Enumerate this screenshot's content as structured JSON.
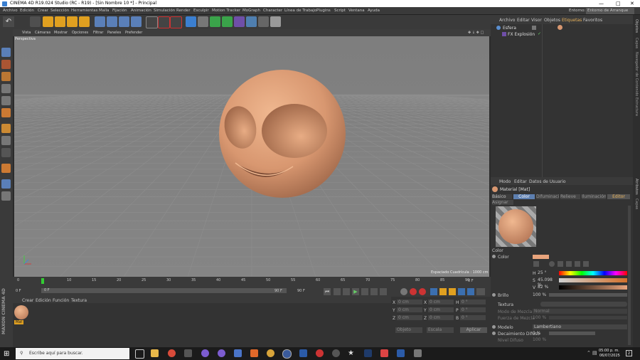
{
  "window": {
    "title": "CINEMA 4D R19.024 Studio (RC - R19) - [Sin Nombre 10 *] - Principal"
  },
  "menu": [
    "Archivo",
    "Edición",
    "Crear",
    "Selección",
    "Herramientas",
    "Malla",
    "Fijación",
    "Animación",
    "Simulación",
    "Render",
    "Esculpir",
    "Motion Tracker",
    "MoGraph",
    "Character",
    "Línea de Trabajo",
    "Plugins",
    "Script",
    "Ventana",
    "Ayuda"
  ],
  "layout_label": "Entorno:",
  "layout_value": "Entorno de Arranque",
  "viewport": {
    "menu": [
      "Vista",
      "Cámaras",
      "Mostrar",
      "Opciones",
      "Filtrar",
      "Paneles",
      "Prefender"
    ],
    "label": "Perspectiva",
    "grid_status": "Espaciado Cuadrícula : 1000 cm"
  },
  "timeline": {
    "ticks": [
      "0",
      "5",
      "10",
      "15",
      "20",
      "25",
      "30",
      "35",
      "40",
      "45",
      "50",
      "55",
      "60",
      "65",
      "70",
      "75",
      "80",
      "85",
      "90"
    ],
    "end_frame": "0 F",
    "current_frame": "0 F",
    "start_field": "0 F",
    "end_field": "90 F",
    "max_field": "90 F"
  },
  "material_manager": {
    "menu": [
      "Crear",
      "Edición",
      "Función",
      "Textura"
    ],
    "material_name": "Mat"
  },
  "coords": {
    "rows": [
      {
        "a": "X",
        "av": "0 cm",
        "b": "X",
        "bv": "0 cm",
        "c": "H",
        "cv": "0 °"
      },
      {
        "a": "Y",
        "av": "0 cm",
        "b": "Y",
        "bv": "0 cm",
        "c": "P",
        "cv": "0 °"
      },
      {
        "a": "Z",
        "av": "0 cm",
        "b": "Z",
        "bv": "0 cm",
        "c": "B",
        "cv": "0 °"
      }
    ],
    "mode": "Objeto",
    "size_mode": "Escala",
    "apply": "Aplicar"
  },
  "object_manager": {
    "menu": [
      "Archivo",
      "Editar",
      "Visor",
      "Objetos",
      "Etiquetas",
      "Favoritos"
    ],
    "items": [
      "Esfera",
      "FX Explosión"
    ]
  },
  "attributes": {
    "menu": [
      "Modo",
      "Editar",
      "Datos de Usuario"
    ],
    "title": "Material [Mat]",
    "tabs": [
      "Básico",
      "Color",
      "Difuminación",
      "Relieve",
      "Iluminación",
      "Editor",
      "Asignar"
    ],
    "section": "Color",
    "color_label": "Color",
    "h_label": "H",
    "h_value": "25 °",
    "s_label": "S",
    "s_value": "45.098 %",
    "v_label": "V",
    "v_value": "82 %",
    "brillo_label": "Brillo",
    "brillo_value": "100 %",
    "textura_label": "Textura",
    "mezcla_label": "Modo de Mezcla",
    "mezcla_value": "Normal",
    "fuerza_label": "Fuerza de Mezcla",
    "fuerza_value": "100 %",
    "modelo_label": "Modelo",
    "modelo_value": "Lambertiano",
    "decaimiento_label": "Decaimiento Difuso",
    "decaimiento_value": "0 %",
    "nivel_label": "Nivel Difuso",
    "nivel_value": "100 %",
    "swatch_color": "#e8a47c"
  },
  "side_tabs": [
    "Objetos",
    "Capas",
    "Navegador de Contenido",
    "Estructura"
  ],
  "side_tabs_lower": [
    "Atributos",
    "Capas"
  ],
  "taskbar": {
    "search_placeholder": "Escribe aquí para buscar.",
    "time": "05:00 p. m.",
    "date": "06/07/2025",
    "notifications": "2"
  },
  "colors": {
    "accent": "#e8b25a",
    "skin": "#d89770",
    "viewport_bg": "#7a7a7a"
  }
}
